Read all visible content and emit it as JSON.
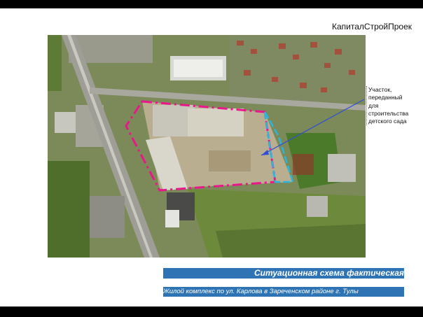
{
  "header": {
    "company": "КапиталСтройПроек"
  },
  "annotation": {
    "lines": [
      "Участок,",
      "переданный",
      "для",
      "строительства",
      "детского сада"
    ],
    "color": "#2f4fd6"
  },
  "footer": {
    "title": "Ситуационная схема фактическая",
    "subtitle": "Жилой комплекс по ул. Карлова в Зареченском районе г. Тулы",
    "bar_color": "#2e74b5"
  },
  "map": {
    "site_boundary_color": "#e8178a",
    "kindergarten_boundary_color": "#29b6e0"
  }
}
